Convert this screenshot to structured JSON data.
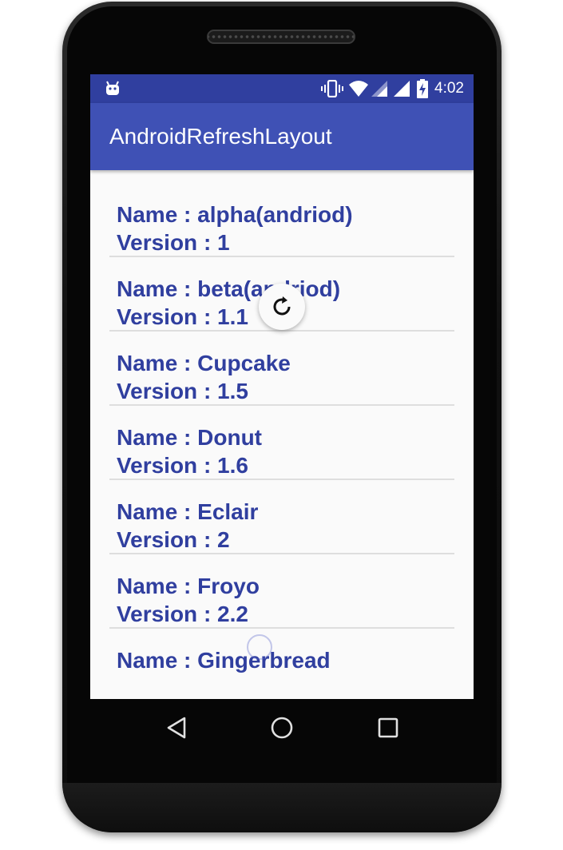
{
  "status_bar": {
    "time": "4:02",
    "icons": [
      "android-notification-icon",
      "vibrate-icon",
      "wifi-icon",
      "signal-icon",
      "signal-icon",
      "battery-charging-icon"
    ]
  },
  "app_bar": {
    "title": "AndroidRefreshLayout"
  },
  "list": {
    "items": [
      {
        "name": "Name : alpha(andriod)",
        "version": "Version : 1"
      },
      {
        "name": "Name : beta(andriod)",
        "version": "Version : 1.1"
      },
      {
        "name": "Name : Cupcake",
        "version": "Version : 1.5"
      },
      {
        "name": "Name : Donut",
        "version": "Version : 1.6"
      },
      {
        "name": "Name : Eclair",
        "version": "Version : 2"
      },
      {
        "name": "Name : Froyo",
        "version": "Version : 2.2"
      },
      {
        "name": "Name : Gingerbread",
        "version": ""
      }
    ]
  },
  "nav_bar": {
    "icons": [
      "back-icon",
      "home-icon",
      "recents-icon"
    ]
  },
  "colors": {
    "primary": "#3f51b5",
    "primary_dark": "#303f9f",
    "text": "#303f9f",
    "background": "#fafafa"
  }
}
